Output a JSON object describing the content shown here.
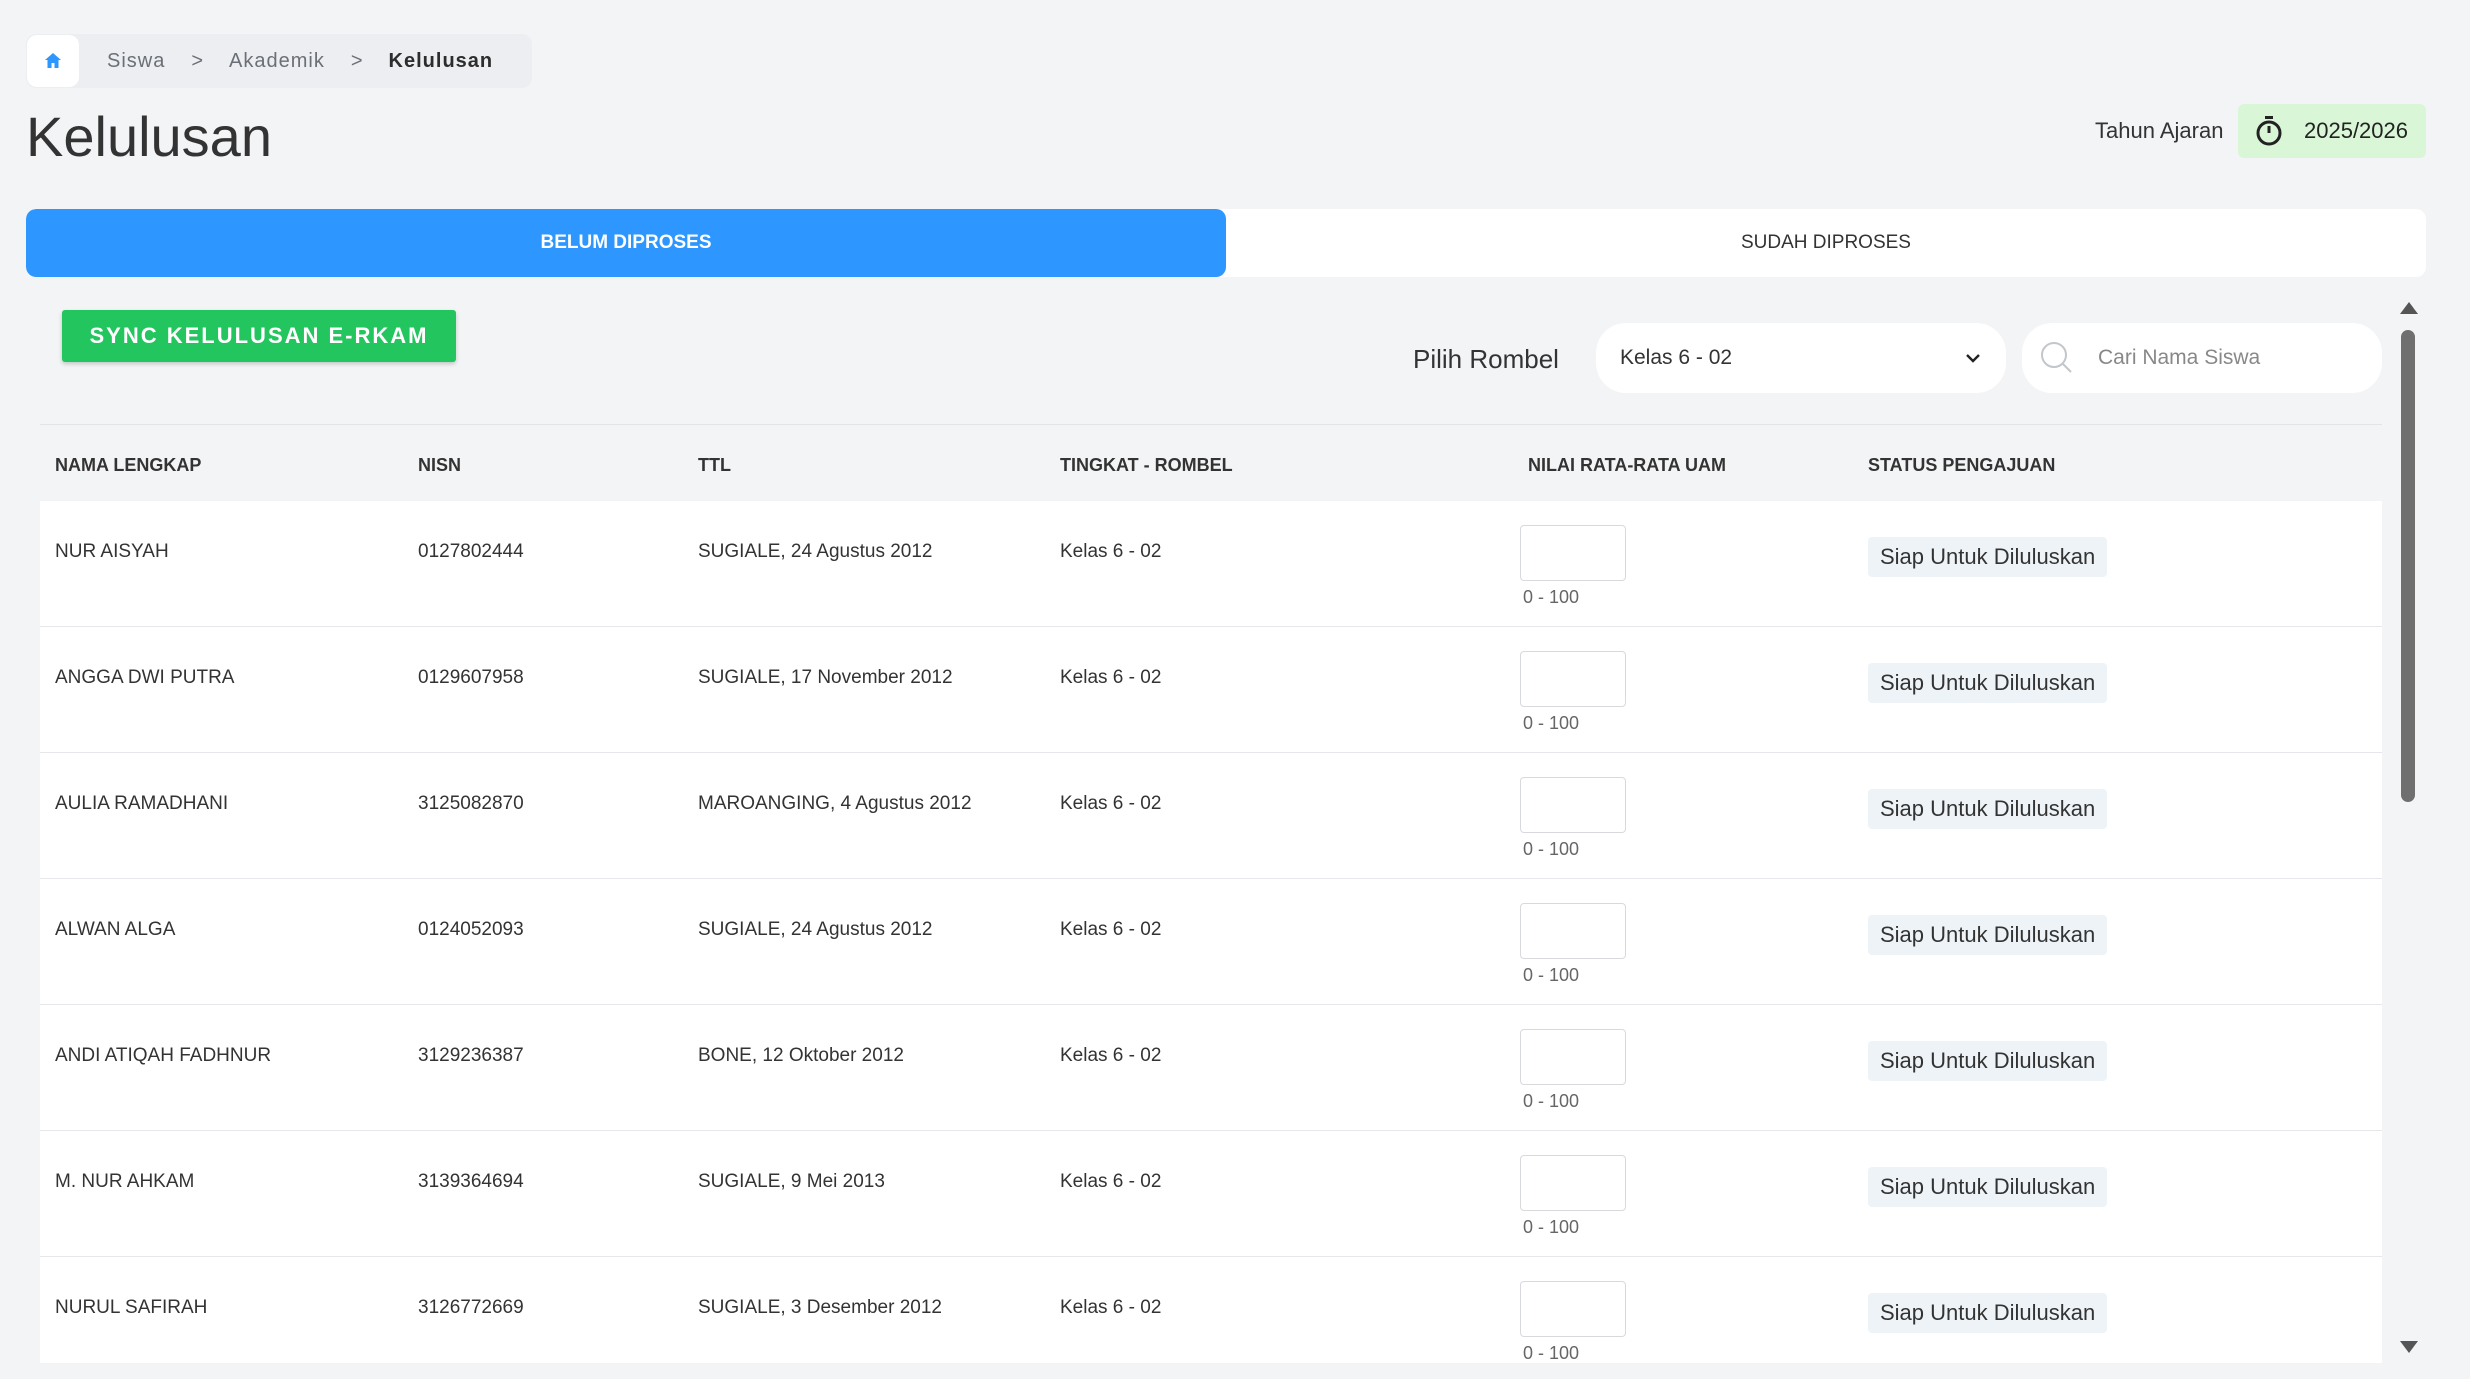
{
  "breadcrumb": {
    "items": [
      "Siswa",
      "Akademik"
    ],
    "separator": ">",
    "current": "Kelulusan"
  },
  "page": {
    "title": "Kelulusan",
    "tahun_ajaran_label": "Tahun Ajaran",
    "tahun_ajaran_value": "2025/2026"
  },
  "tabs": [
    {
      "label": "BELUM DIPROSES",
      "active": true
    },
    {
      "label": "SUDAH DIPROSES",
      "active": false
    }
  ],
  "toolbar": {
    "sync_label": "SYNC KELULUSAN E-RKAM",
    "rombel_label": "Pilih Rombel",
    "rombel_value": "Kelas 6 - 02",
    "search_placeholder": "Cari Nama Siswa"
  },
  "table": {
    "headers": {
      "nama": "NAMA LENGKAP",
      "nisn": "NISN",
      "ttl": "TTL",
      "tingkat": "TINGKAT - ROMBEL",
      "nilai": "NILAI RATA-RATA UAM",
      "status": "STATUS PENGAJUAN"
    },
    "nilai_hint": "0 - 100",
    "rows": [
      {
        "nama": "NUR AISYAH",
        "nisn": "0127802444",
        "ttl": "SUGIALE, 24 Agustus 2012",
        "tingkat": "Kelas 6 - 02",
        "status": "Siap Untuk Diluluskan"
      },
      {
        "nama": "ANGGA DWI PUTRA",
        "nisn": "0129607958",
        "ttl": "SUGIALE, 17 November 2012",
        "tingkat": "Kelas 6 - 02",
        "status": "Siap Untuk Diluluskan"
      },
      {
        "nama": "AULIA RAMADHANI",
        "nisn": "3125082870",
        "ttl": "MAROANGING, 4 Agustus 2012",
        "tingkat": "Kelas 6 - 02",
        "status": "Siap Untuk Diluluskan"
      },
      {
        "nama": "ALWAN ALGA",
        "nisn": "0124052093",
        "ttl": "SUGIALE, 24 Agustus 2012",
        "tingkat": "Kelas 6 - 02",
        "status": "Siap Untuk Diluluskan"
      },
      {
        "nama": "ANDI ATIQAH FADHNUR",
        "nisn": "3129236387",
        "ttl": "BONE, 12 Oktober 2012",
        "tingkat": "Kelas 6 - 02",
        "status": "Siap Untuk Diluluskan"
      },
      {
        "nama": "M. NUR AHKAM",
        "nisn": "3139364694",
        "ttl": "SUGIALE, 9 Mei 2013",
        "tingkat": "Kelas 6 - 02",
        "status": "Siap Untuk Diluluskan"
      },
      {
        "nama": "NURUL SAFIRAH",
        "nisn": "3126772669",
        "ttl": "SUGIALE, 3 Desember 2012",
        "tingkat": "Kelas 6 - 02",
        "status": "Siap Untuk Diluluskan"
      }
    ]
  },
  "colors": {
    "accent": "#2d96ff",
    "sync_green": "#22c55e",
    "badge_green_bg": "#d9f7d7"
  },
  "icons": {
    "home": "home-icon",
    "timer": "stopwatch-icon",
    "chevron": "chevron-down-icon",
    "search": "search-icon"
  }
}
